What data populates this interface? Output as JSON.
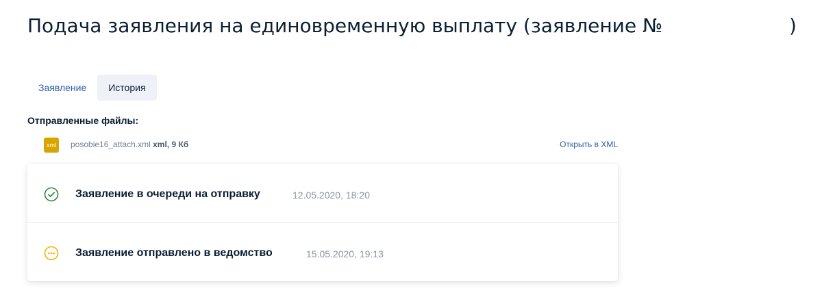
{
  "page": {
    "title": "Подача заявления на единовременную выплату (заявление №",
    "title_close": ")"
  },
  "tabs": [
    {
      "label": "Заявление",
      "active": false
    },
    {
      "label": "История",
      "active": true
    }
  ],
  "files": {
    "heading": "Отправленные файлы:",
    "items": [
      {
        "icon_label": "xml",
        "name": "posobie16_attach.xml",
        "meta": "xml, 9 Кб",
        "action": "Открыть в XML"
      }
    ]
  },
  "history": [
    {
      "status": "Заявление в очереди на отправку",
      "date": "12.05.2020, 18:20",
      "icon": "check-circle-icon",
      "color": "#2e8b3b"
    },
    {
      "status": "Заявление отправлено в ведомство",
      "date": "15.05.2020, 19:13",
      "icon": "pending-circle-icon",
      "color": "#f2b400"
    }
  ]
}
